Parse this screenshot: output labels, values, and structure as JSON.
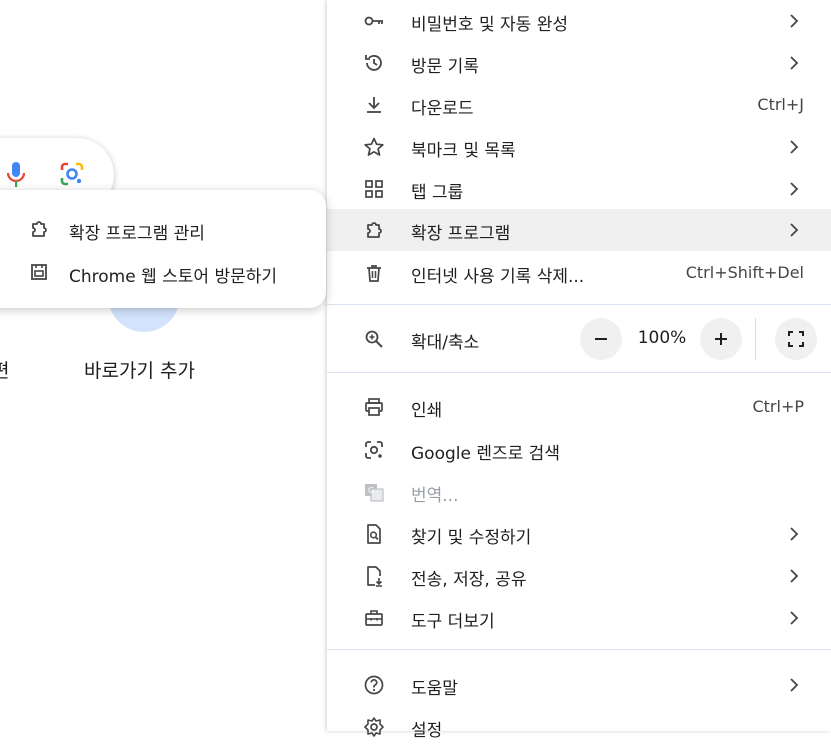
{
  "background": {
    "shortcut_label": "바로가기 추가",
    "cut_label": "편"
  },
  "submenu": {
    "items": [
      {
        "label": "확장 프로그램 관리",
        "icon": "extension-icon"
      },
      {
        "label": "Chrome 웹 스토어 방문하기",
        "icon": "web-store-icon"
      }
    ]
  },
  "menu": {
    "items": [
      {
        "label": "비밀번호 및 자동 완성",
        "icon": "key-icon",
        "submenu": true
      },
      {
        "label": "방문 기록",
        "icon": "history-icon",
        "submenu": true
      },
      {
        "label": "다운로드",
        "icon": "download-icon",
        "shortcut": "Ctrl+J"
      },
      {
        "label": "북마크 및 목록",
        "icon": "star-icon",
        "submenu": true
      },
      {
        "label": "탭 그룹",
        "icon": "grid-icon",
        "submenu": true
      },
      {
        "label": "확장 프로그램",
        "icon": "extension-icon",
        "submenu": true,
        "highlighted": true
      },
      {
        "label": "인터넷 사용 기록 삭제...",
        "icon": "trash-icon",
        "shortcut": "Ctrl+Shift+Del"
      }
    ],
    "zoom": {
      "label": "확대/축소",
      "icon": "zoom-icon",
      "value": "100%",
      "minus": "−",
      "plus": "+"
    },
    "items2": [
      {
        "label": "인쇄",
        "icon": "print-icon",
        "shortcut": "Ctrl+P"
      },
      {
        "label": "Google 렌즈로 검색",
        "icon": "lens-icon"
      },
      {
        "label": "번역...",
        "icon": "translate-icon",
        "disabled": true
      },
      {
        "label": "찾기 및 수정하기",
        "icon": "find-page-icon",
        "submenu": true
      },
      {
        "label": "전송, 저장, 공유",
        "icon": "file-save-icon",
        "submenu": true
      },
      {
        "label": "도구 더보기",
        "icon": "toolbox-icon",
        "submenu": true
      }
    ],
    "items3": [
      {
        "label": "도움말",
        "icon": "help-icon",
        "submenu": true
      },
      {
        "label": "설정",
        "icon": "settings-icon"
      }
    ]
  }
}
